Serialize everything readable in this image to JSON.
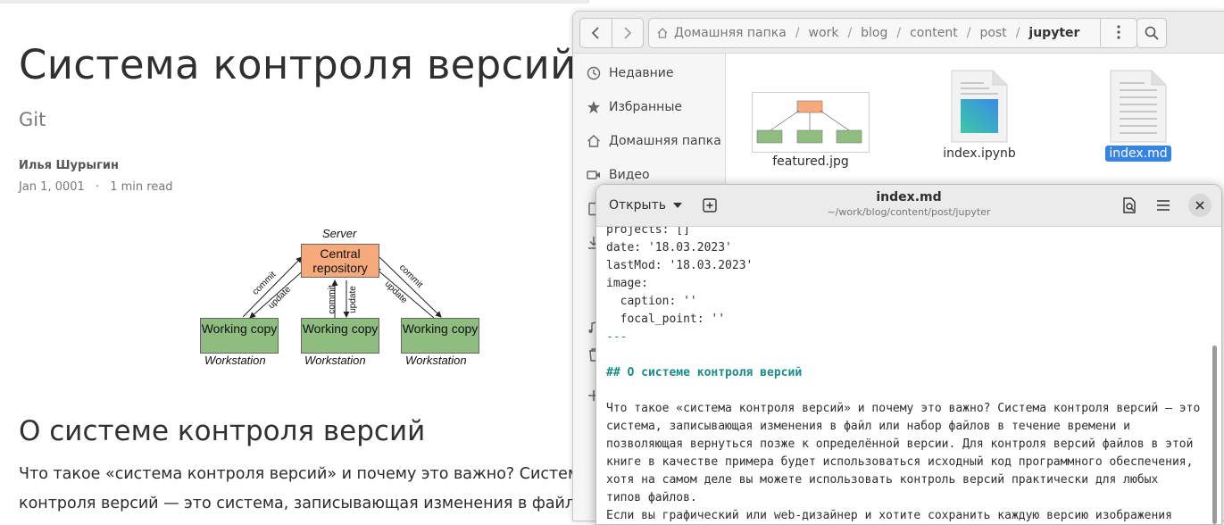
{
  "blog": {
    "title": "Система контроля версий",
    "subtitle": "Git",
    "author": "Илья Шурыгин",
    "date": "Jan 1, 0001",
    "dot": "·",
    "read_time": "1 min read",
    "section_heading": "О системе контроля версий",
    "para_lines": [
      "Что такое «система контроля версий» и почему это важно? Система",
      "контроля версий — это система, записывающая изменения в файл"
    ],
    "diagram": {
      "server_label": "Server",
      "central_repo": "Central repository",
      "working_copy": "Working copy",
      "workstation": "Workstation",
      "commit": "commit",
      "update": "update"
    }
  },
  "file_manager": {
    "path": [
      "Домашняя папка",
      "work",
      "blog",
      "content",
      "post",
      "jupyter"
    ],
    "sidebar": [
      {
        "label": "Недавние",
        "icon": "clock-icon"
      },
      {
        "label": "Избранные",
        "icon": "star-icon"
      },
      {
        "label": "Домашняя папка",
        "icon": "home-icon"
      },
      {
        "label": "Видео",
        "icon": "video-icon"
      }
    ],
    "files": [
      {
        "name": "featured.jpg",
        "type": "image"
      },
      {
        "name": "index.ipynb",
        "type": "notebook"
      },
      {
        "name": "index.md",
        "type": "text",
        "selected": true
      }
    ]
  },
  "editor": {
    "open_label": "Открыть",
    "title": "index.md",
    "path": "~/work/blog/content/post/jupyter",
    "lines": [
      "projects: []",
      "date: '18.03.2023'",
      "lastMod: '18.03.2023'",
      "image:",
      "  caption: ''",
      "  focal_point: ''",
      "---",
      "",
      "## О системе контроля версий",
      "",
      "Что такое «система контроля версий» и почему это важно? Система контроля версий — это",
      "система, записывающая изменения в файл или набор файлов в течение времени и",
      "позволяющая вернуться позже к определённой версии. Для контроля версий файлов в этой",
      "книге в качестве примера будет использоваться исходный код программного обеспечения,",
      "хотя на самом деле вы можете использовать контроль версий практически для любых",
      "типов файлов.",
      "Если вы графический или web-дизайнер и хотите сохранить каждую версию изображения"
    ]
  },
  "colors": {
    "accent": "#3584e4",
    "repo_box": "#f6a97a",
    "working_box": "#8fbc7f",
    "heading_md": "#1c8a8a"
  }
}
